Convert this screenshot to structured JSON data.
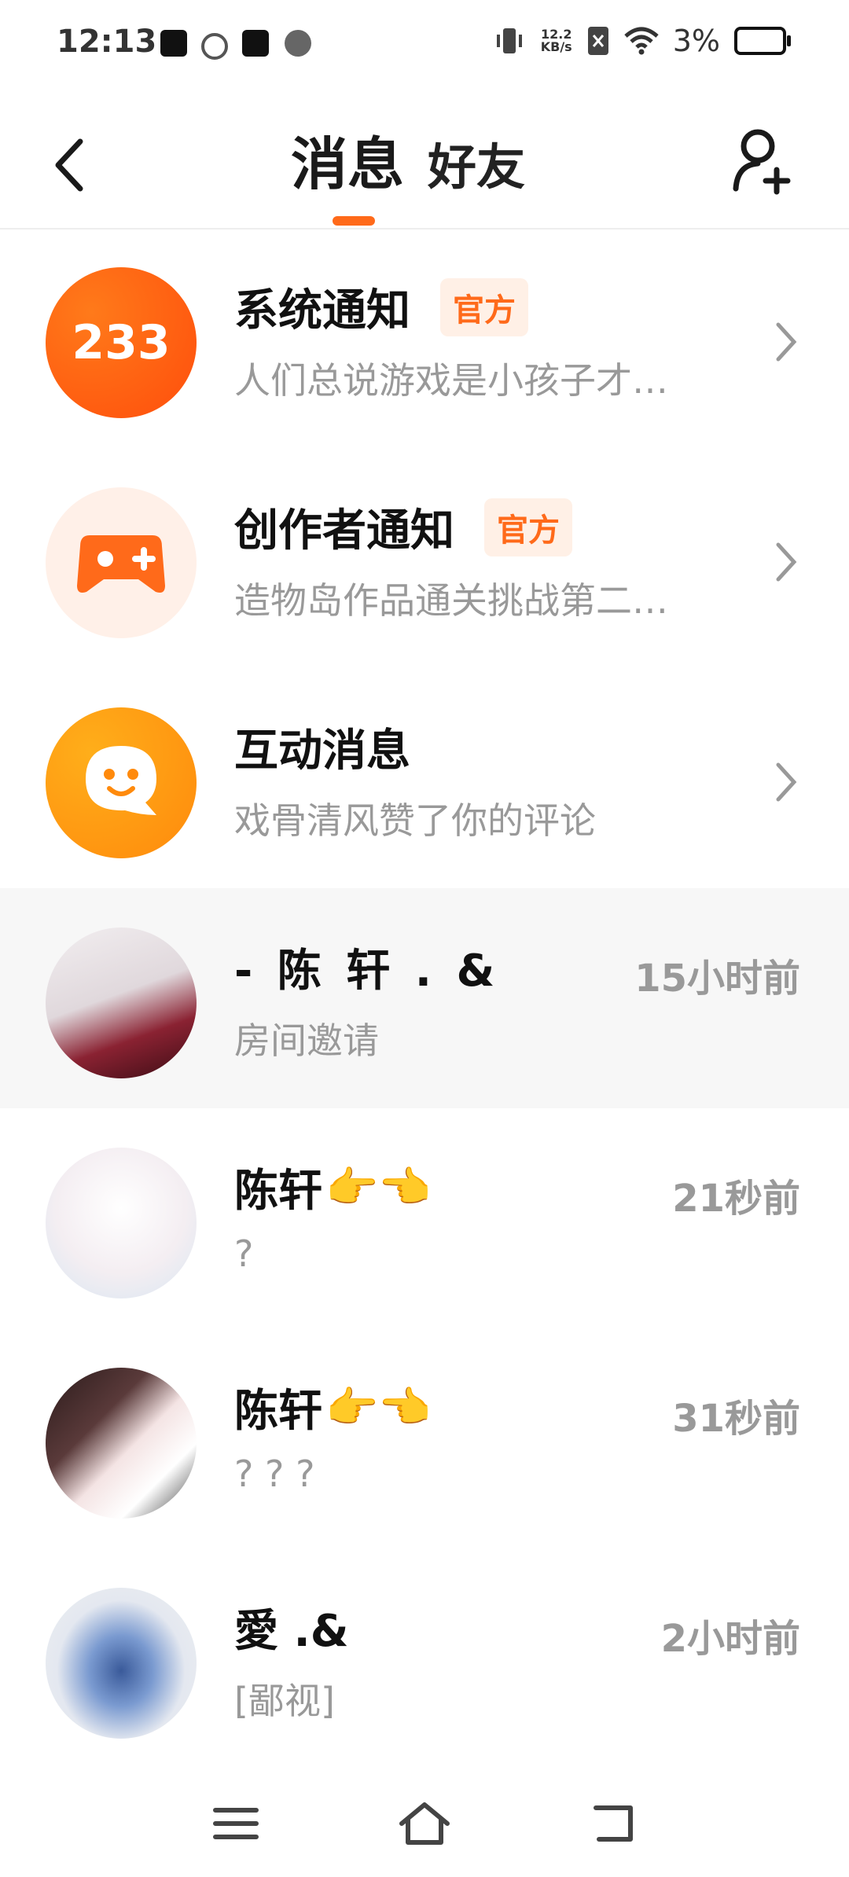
{
  "status_bar": {
    "time": "12:13",
    "speed_value": "12.2",
    "speed_unit": "KB/s",
    "battery": "3%"
  },
  "header": {
    "tabs": [
      {
        "label": "消息",
        "active": true
      },
      {
        "label": "好友",
        "active": false
      }
    ],
    "accent_color": "#ff6a1a"
  },
  "notifications": [
    {
      "title": "系统通知",
      "badge": "官方",
      "preview": "人们总说游戏是小孩子才…",
      "icon": "233-logo"
    },
    {
      "title": "创作者通知",
      "badge": "官方",
      "preview": "造物岛作品通关挑战第二…",
      "icon": "gamepad-icon"
    },
    {
      "title": "互动消息",
      "badge": "",
      "preview": "戏骨清风赞了你的评论",
      "icon": "chat-bubble-icon"
    }
  ],
  "chats": [
    {
      "name": "- 陈 轩 . &",
      "emoji": "",
      "message": "房间邀请",
      "time": "15小时前",
      "highlighted": true
    },
    {
      "name": "陈轩",
      "emoji": "👉👈",
      "message": "?",
      "time": "21秒前",
      "highlighted": false
    },
    {
      "name": "陈轩",
      "emoji": "👉👈",
      "message": "? ? ?",
      "time": "31秒前",
      "highlighted": false
    },
    {
      "name": "愛 .&",
      "emoji": "",
      "message": "[鄙视]",
      "time": "2小时前",
      "highlighted": false
    }
  ]
}
